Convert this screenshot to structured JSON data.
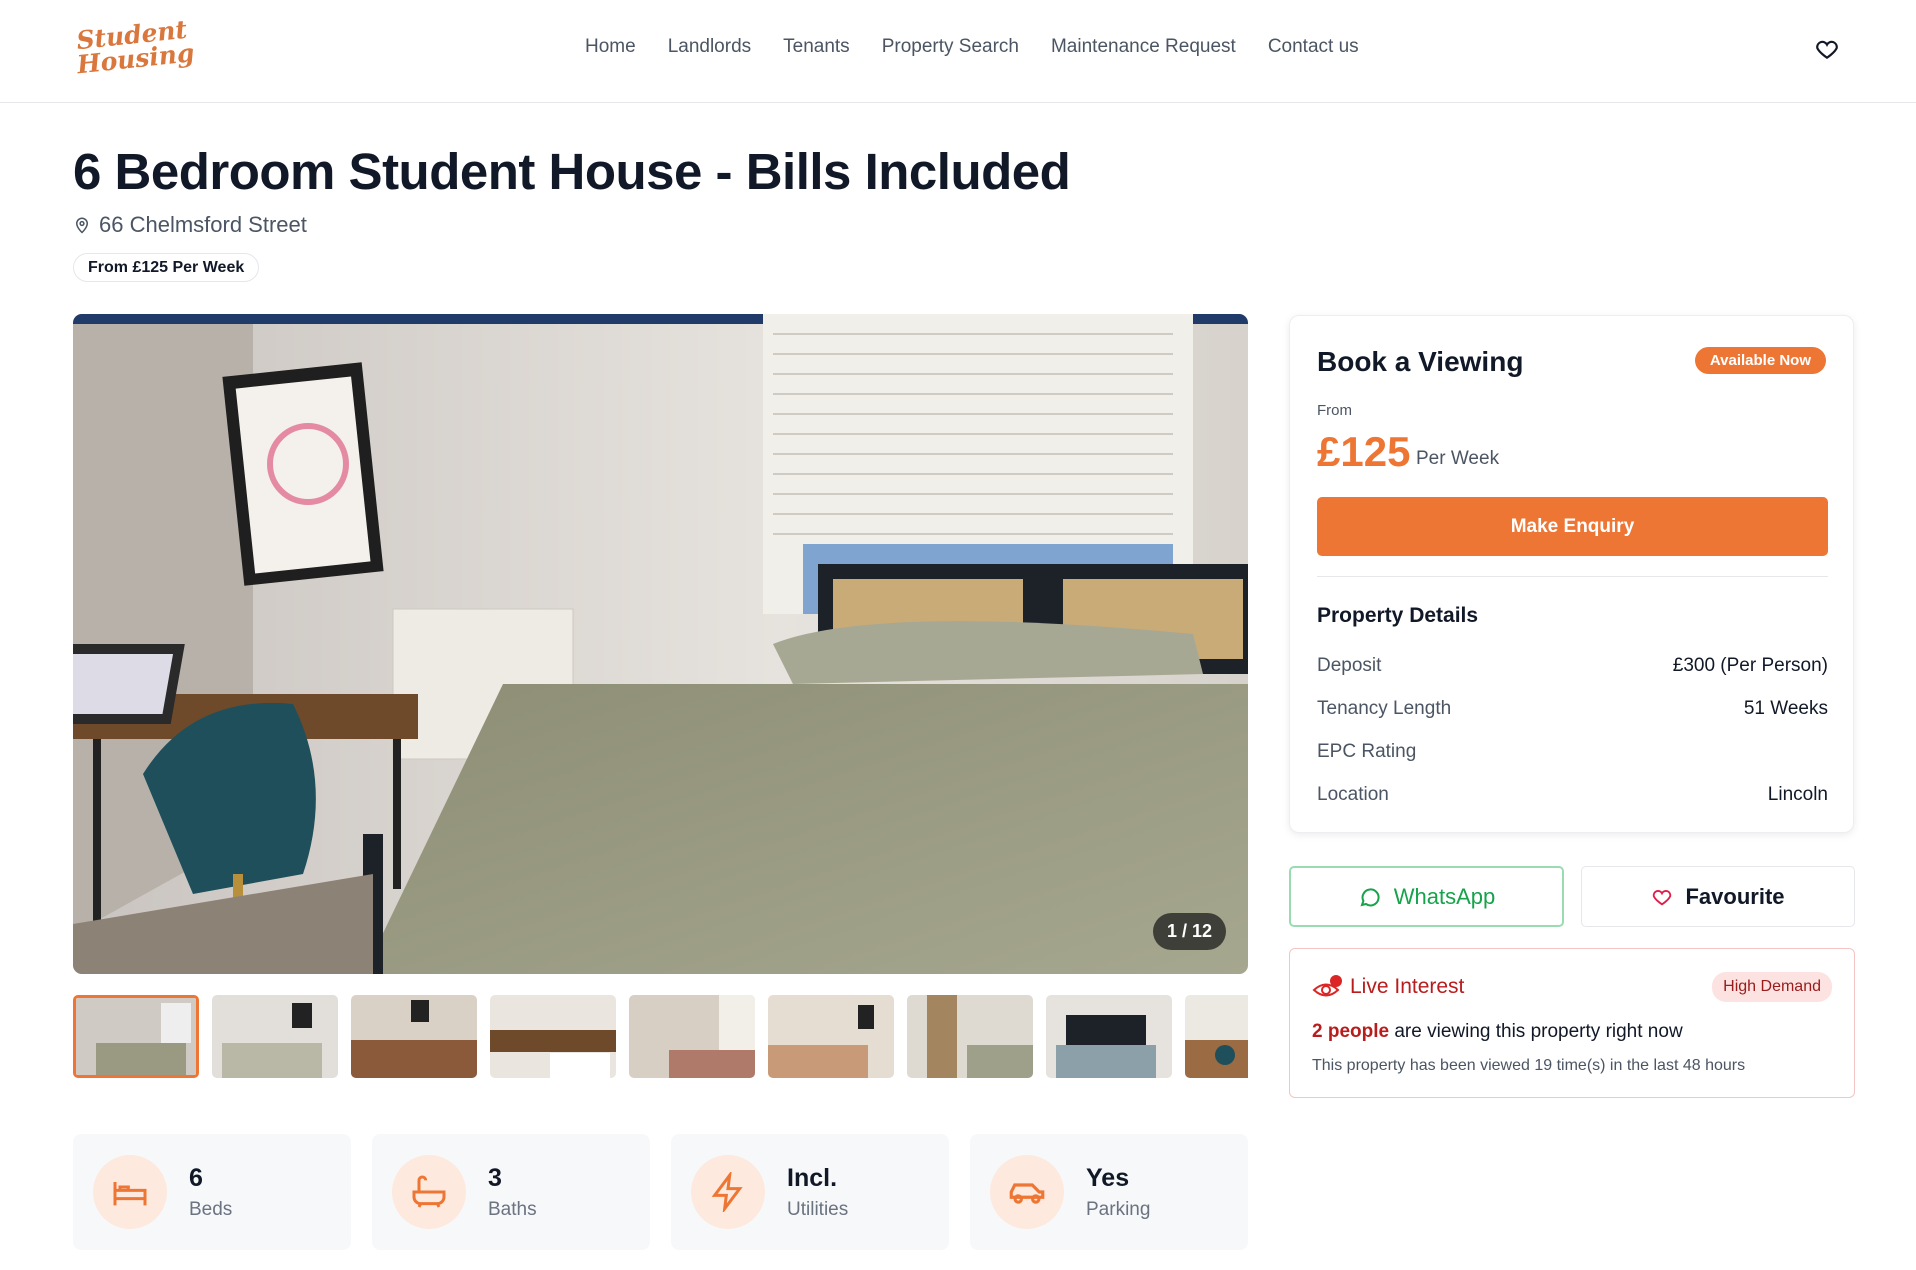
{
  "header": {
    "logo_line1": "Student",
    "logo_line2": "Housing",
    "nav": [
      "Home",
      "Landlords",
      "Tenants",
      "Property Search",
      "Maintenance Request",
      "Contact us"
    ],
    "favourites_icon": "heart-icon"
  },
  "listing": {
    "title": "6 Bedroom Student House - Bills Included",
    "address": "66 Chelmsford Street",
    "price_chip": "From £125 Per Week"
  },
  "gallery": {
    "counter": "1 / 12",
    "thumbnail_count": 9
  },
  "features": [
    {
      "icon": "bed-icon",
      "value": "6",
      "label": "Beds"
    },
    {
      "icon": "bath-icon",
      "value": "3",
      "label": "Baths"
    },
    {
      "icon": "lightning-icon",
      "value": "Incl.",
      "label": "Utilities"
    },
    {
      "icon": "car-icon",
      "value": "Yes",
      "label": "Parking"
    }
  ],
  "booking": {
    "title": "Book a Viewing",
    "badge": "Available Now",
    "from_label": "From",
    "price": "£125",
    "price_unit": "Per Week",
    "enquiry_button": "Make Enquiry",
    "details_title": "Property Details",
    "details": [
      {
        "label": "Deposit",
        "value": "£300 (Per Person)"
      },
      {
        "label": "Tenancy Length",
        "value": "51 Weeks"
      },
      {
        "label": "EPC Rating",
        "value": ""
      },
      {
        "label": "Location",
        "value": "Lincoln"
      }
    ]
  },
  "actions": {
    "whatsapp": "WhatsApp",
    "favourite": "Favourite"
  },
  "live_interest": {
    "title": "Live Interest",
    "badge": "High Demand",
    "viewers_count": "2 people",
    "viewers_text": " are viewing this property right now",
    "views_text": "This property has been viewed 19 time(s) in the last 48 hours"
  },
  "colors": {
    "accent": "#ee7634",
    "whatsapp": "#16a34a",
    "alert": "#b91c1c"
  }
}
